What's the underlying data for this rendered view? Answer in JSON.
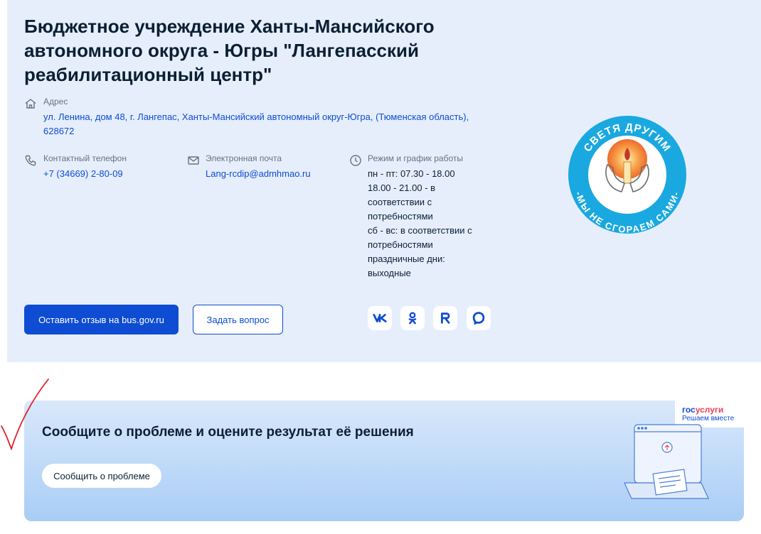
{
  "organization": {
    "title": "Бюджетное учреждение Ханты-Мансийского автономного округа - Югры \"Лангепасский реабилитационный центр\""
  },
  "address": {
    "label": "Адрес",
    "value": "ул. Ленина, дом 48, г. Лангепас, Ханты-Мансийский автономный округ-Югра, (Тюменская область), 628672"
  },
  "phone": {
    "label": "Контактный телефон",
    "value": "+7 (34669) 2-80-09"
  },
  "email": {
    "label": "Электронная почта",
    "value": "Lang-rcdip@admhmao.ru"
  },
  "schedule": {
    "label": "Режим и график работы",
    "lines": [
      "пн - пт: 07.30 - 18.00",
      "18.00 - 21.00 - в",
      "соответствии с",
      "потребностями",
      "сб - вс: в соответствии с",
      "потребностями",
      "праздничные дни:",
      "выходные"
    ]
  },
  "actions": {
    "review_label": "Оставить отзыв на bus.gov.ru",
    "question_label": "Задать вопрос"
  },
  "social": [
    "vk-icon",
    "odnoklassniki-icon",
    "rutube-icon",
    "max-messenger-icon"
  ],
  "logo": {
    "top_text": "СВЕТЯ ДРУГИМ",
    "bottom_text": "-МЫ НЕ СГОРАЕМ САМИ-"
  },
  "report": {
    "title": "Сообщите о проблеме и оцените результат её решения",
    "button_label": "Сообщить о проблеме",
    "brand_part1": "гос",
    "brand_part2": "услуги",
    "brand_tagline": "Решаем вместе"
  },
  "colors": {
    "accent": "#0d4cd3",
    "panel": "#e6eefc",
    "annotation": "#e0202a"
  }
}
